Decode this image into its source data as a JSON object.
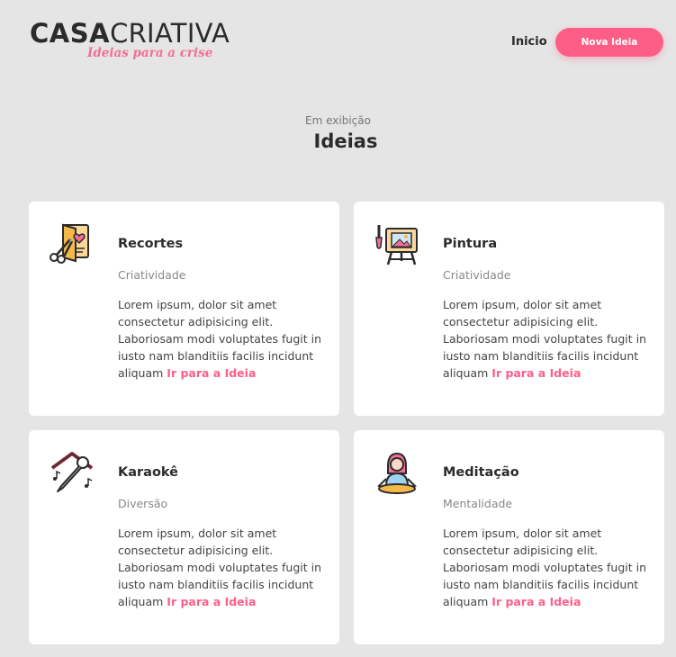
{
  "header": {
    "logo_bold": "CASA",
    "logo_light": "CRIATIVA",
    "logo_tagline": "Ideias para a crise",
    "nav_home": "Inicio",
    "new_idea_button": "Nova Ideia",
    "accent_color": "#fe5e86"
  },
  "section": {
    "subtitle": "Em exibição",
    "title": "Ideias"
  },
  "cards": [
    {
      "title": "Recortes",
      "category": "Criatividade",
      "description": "Lorem ipsum, dolor sit amet consectetur adipisicing elit. Laboriosam modi voluptates fugit in iusto nam blanditiis facilis incidunt aliquam",
      "link": "Ir para a Ideia",
      "icon": "scissors-card-icon"
    },
    {
      "title": "Pintura",
      "category": "Criatividade",
      "description": "Lorem ipsum, dolor sit amet consectetur adipisicing elit. Laboriosam modi voluptates fugit in iusto nam blanditiis facilis incidunt aliquam",
      "link": "Ir para a Ideia",
      "icon": "easel-painting-icon"
    },
    {
      "title": "Karaokê",
      "category": "Diversão",
      "description": "Lorem ipsum, dolor sit amet consectetur adipisicing elit. Laboriosam modi voluptates fugit in iusto nam blanditiis facilis incidunt aliquam",
      "link": "Ir para a Ideia",
      "icon": "microphone-house-icon"
    },
    {
      "title": "Meditação",
      "category": "Mentalidade",
      "description": "Lorem ipsum, dolor sit amet consectetur adipisicing elit. Laboriosam modi voluptates fugit in iusto nam blanditiis facilis incidunt aliquam",
      "link": "Ir para a Ideia",
      "icon": "meditation-person-icon"
    }
  ]
}
